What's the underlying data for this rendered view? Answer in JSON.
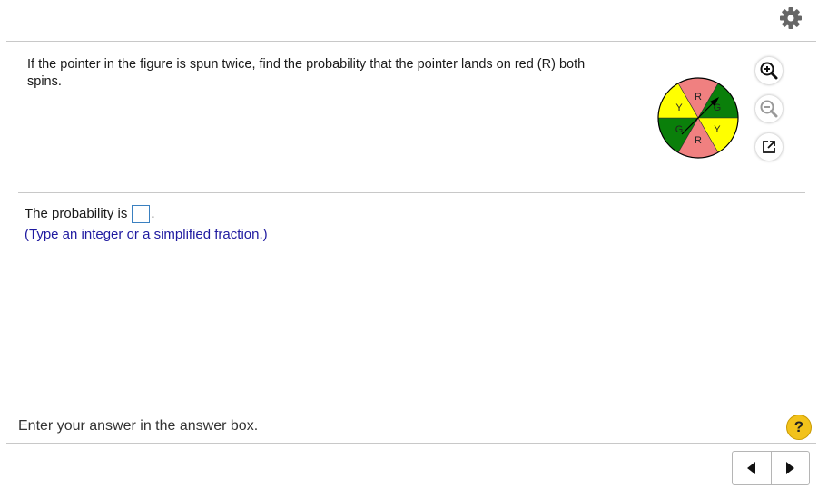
{
  "header": {
    "settings_icon": "gear-icon"
  },
  "question": {
    "text": "If the pointer in the figure is spun twice, find the probability that the pointer lands on red (R) both spins."
  },
  "figure": {
    "spinner_sections": [
      {
        "label": "R",
        "color": "#f08080"
      },
      {
        "label": "G",
        "color": "#0a7f0a"
      },
      {
        "label": "Y",
        "color": "#ffff00"
      },
      {
        "label": "R",
        "color": "#f08080"
      },
      {
        "label": "G",
        "color": "#0a7f0a"
      },
      {
        "label": "Y",
        "color": "#ffff00"
      }
    ]
  },
  "tools": {
    "zoom_in_icon": "zoom-in-icon",
    "zoom_out_icon": "zoom-out-icon",
    "popout_icon": "popout-icon"
  },
  "answer": {
    "prefix": "The probability is",
    "suffix": ".",
    "value": "",
    "hint": "(Type an integer or a simplified fraction.)"
  },
  "footer": {
    "instruction": "Enter your answer in the answer box.",
    "help_label": "?",
    "prev_icon": "triangle-left-icon",
    "next_icon": "triangle-right-icon"
  },
  "colors": {
    "accent": "#3a80c0",
    "hint": "#1f1aa0",
    "help": "#f2c21b"
  }
}
